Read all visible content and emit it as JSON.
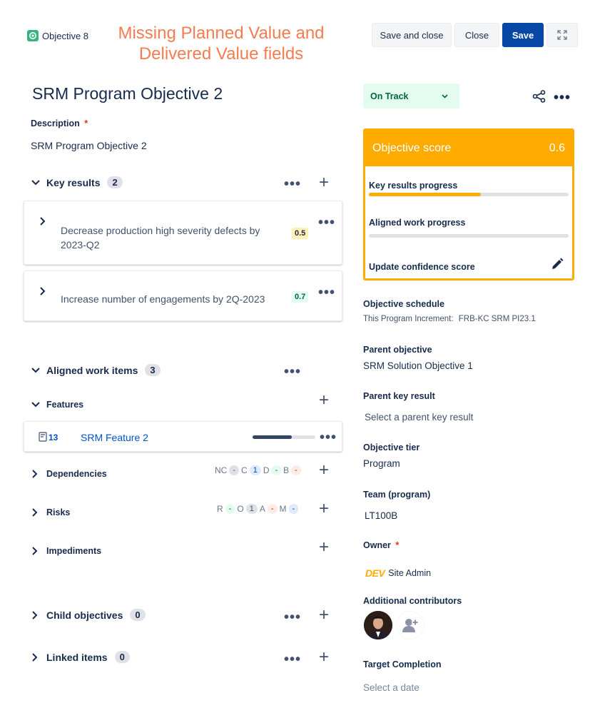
{
  "header": {
    "badge_label": "Objective 8",
    "annotation_line1": "Missing Planned Value and",
    "annotation_line2": "Delivered Value fields",
    "annotation_color": "#f47c50",
    "save_close_label": "Save and close",
    "close_label": "Close",
    "save_label": "Save"
  },
  "objective": {
    "title": "SRM Program Objective 2",
    "description_label": "Description",
    "required_mark": "*",
    "description": "SRM Program Objective 2"
  },
  "key_results": {
    "label": "Key results",
    "count": "2",
    "items": [
      {
        "text_line1": "Decrease production high severity defects by",
        "text_line2": "2023-Q2",
        "score": "0.5",
        "score_color": "#fff0b3"
      },
      {
        "text_line1": "Increase number of engagements by 2Q-2023",
        "text_line2": "",
        "score": "0.7",
        "score_color": "#e3fcef"
      }
    ]
  },
  "aligned": {
    "label": "Aligned work items",
    "count": "3",
    "features_label": "Features",
    "feature": {
      "count": "13",
      "name": "SRM Feature 2",
      "progress": 0.62
    },
    "dependencies_label": "Dependencies",
    "dependencies": {
      "nc_label": "NC",
      "nc": "-",
      "c_label": "C",
      "c": "1",
      "d_label": "D",
      "d": "-",
      "b_label": "B",
      "b": "-"
    },
    "risks_label": "Risks",
    "risks": {
      "r_label": "R",
      "r": "-",
      "o_label": "O",
      "o": "1",
      "a_label": "A",
      "a": "-",
      "m_label": "M",
      "m": "-"
    },
    "impediments_label": "Impediments"
  },
  "child_objectives": {
    "label": "Child objectives",
    "count": "0"
  },
  "linked_items": {
    "label": "Linked items",
    "count": "0"
  },
  "status": {
    "label": "On Track",
    "bg": "#e3fcef",
    "color": "#006644"
  },
  "score_panel": {
    "title": "Objective score",
    "value": "0.6",
    "accent": "#ffab00",
    "key_results_label": "Key results progress",
    "key_results_progress": 0.56,
    "aligned_label": "Aligned work progress",
    "aligned_progress": 0,
    "confidence_label": "Update confidence score"
  },
  "details": {
    "schedule_label": "Objective schedule",
    "schedule_prefix": "This Program Increment:",
    "schedule_value": "FRB-KC SRM PI23.1",
    "parent_objective_label": "Parent objective",
    "parent_objective": "SRM Solution Objective 1",
    "parent_kr_label": "Parent key result",
    "parent_kr_placeholder": "Select a parent key result",
    "tier_label": "Objective tier",
    "tier": "Program",
    "team_label": "Team (program)",
    "team": "LT100B",
    "owner_label": "Owner",
    "owner_logo": "DEV",
    "owner_name": "Site Admin",
    "contributors_label": "Additional contributors",
    "target_label": "Target Completion",
    "target_placeholder": "Select a date"
  }
}
